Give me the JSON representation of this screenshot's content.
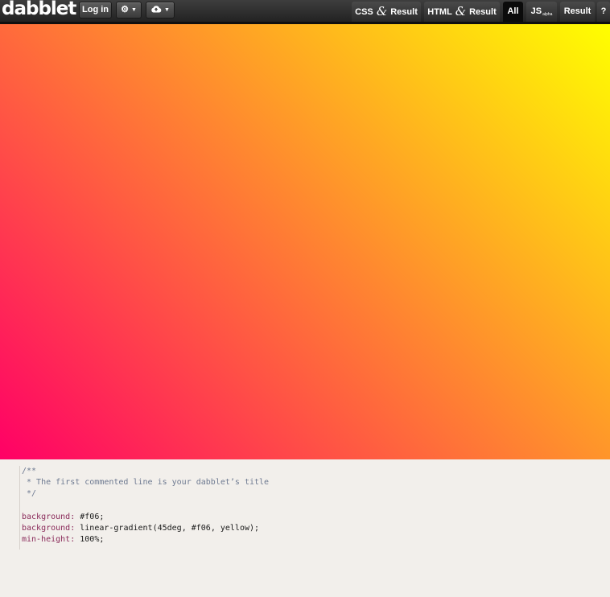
{
  "app": {
    "logo": "dabblet"
  },
  "toolbar": {
    "login_label": "Log in",
    "settings_icon": "gear-icon",
    "cloud_icon": "cloud-icon"
  },
  "tabs": [
    {
      "label": "CSS",
      "label2": "Result",
      "active": false
    },
    {
      "label": "HTML",
      "label2": "Result",
      "active": false
    },
    {
      "label": "All",
      "active": true
    },
    {
      "label": "JS",
      "sub": "alpha",
      "active": false
    },
    {
      "label": "Result",
      "active": false
    },
    {
      "label": "?",
      "active": false
    }
  ],
  "result": {
    "gradient_start": "#f06",
    "gradient_end": "yellow"
  },
  "code": {
    "c1": "/**",
    "c2": " * The first commented line is your dabblet’s title",
    "c3": " */",
    "l1_prop": "background",
    "l1_val": " #f06;",
    "l2_prop": "background",
    "l2_val": " linear-gradient(45deg, #f06, yellow);",
    "l3_prop": "min-height",
    "l3_val": " 100%;"
  }
}
